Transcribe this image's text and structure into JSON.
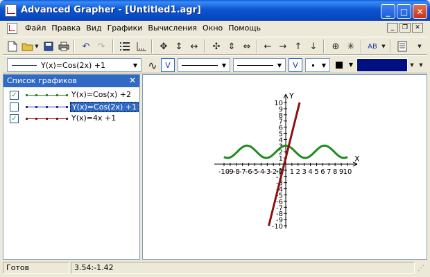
{
  "window": {
    "title": "Advanced Grapher - [Untitled1.agr]",
    "minimize": "_",
    "maximize": "□",
    "close": "✕"
  },
  "menu": {
    "items": [
      "Файл",
      "Правка",
      "Вид",
      "Графики",
      "Вычисления",
      "Окно",
      "Помощь"
    ],
    "mdi_minimize": "_",
    "mdi_restore": "❐",
    "mdi_close": "✕"
  },
  "toolbar2": {
    "graph_select": "Y(x)=Cos(2x) +1",
    "text_style": "AB"
  },
  "panel": {
    "title": "Список графиков",
    "graphs": [
      {
        "checked": true,
        "label": "Y(x)=Cos(x) +2",
        "color": "#1F8A1F"
      },
      {
        "checked": false,
        "label": "Y(x)=Cos(2x) +1",
        "color": "#1A2EA0",
        "selected": true
      },
      {
        "checked": true,
        "label": "Y(x)=4x +1",
        "color": "#8B1010"
      }
    ]
  },
  "plot": {
    "x_label": "X",
    "y_label": "Y",
    "x_range": [
      -10,
      10
    ],
    "y_range": [
      -10,
      10
    ],
    "x_ticks": [
      -10,
      -9,
      -8,
      -7,
      -6,
      -5,
      -4,
      -3,
      -2,
      -1,
      1,
      2,
      3,
      4,
      5,
      6,
      7,
      8,
      9,
      10
    ],
    "y_ticks": [
      10,
      9,
      8,
      7,
      6,
      5,
      4,
      3,
      2,
      1,
      -1,
      -2,
      -3,
      -4,
      -5,
      -6,
      -7,
      -8,
      -9,
      -10
    ],
    "origin_label": "0",
    "curves": [
      {
        "expr": "Y(x)=Cos(x) +2",
        "color": "#1F8A1F",
        "visible": true
      },
      {
        "expr": "Y(x)=4x +1",
        "color": "#8B1010",
        "visible": true
      }
    ]
  },
  "status": {
    "state": "Готов",
    "coords": "3.54:-1.42"
  },
  "colors": {
    "accent": "#316AC5",
    "titlebar": "#0A5FD8",
    "cos_curve": "#1F8A1F",
    "linear_curve": "#8B1010",
    "selected_color": "#001080"
  }
}
